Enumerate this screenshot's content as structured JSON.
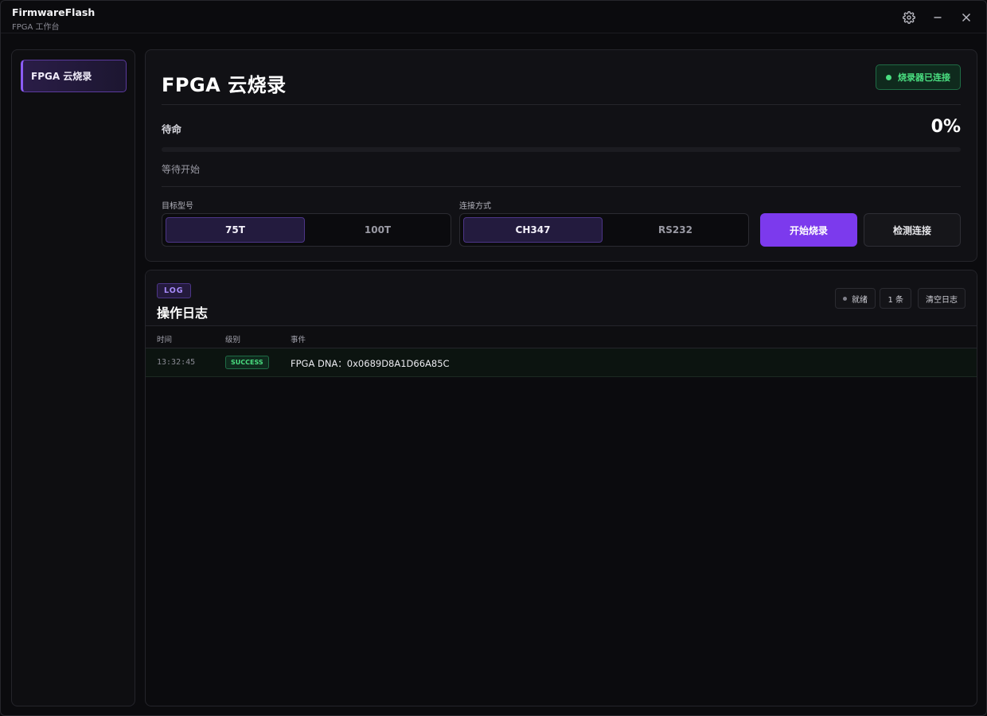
{
  "app": {
    "title": "FirmwareFlash",
    "subtitle": "FPGA 工作台"
  },
  "window_controls": {
    "settings_icon": "gear-icon",
    "minimize_icon": "minimize-icon",
    "close_icon": "close-icon"
  },
  "sidebar": {
    "items": [
      {
        "label": "FPGA 云烧录",
        "active": true
      }
    ]
  },
  "flash": {
    "title": "FPGA 云烧录",
    "connection_badge": "烧录器已连接",
    "status_label": "待命",
    "percent_text": "0%",
    "progress_fraction": 0,
    "status_message": "等待开始",
    "target_model": {
      "label": "目标型号",
      "options": [
        "75T",
        "100T"
      ],
      "selected": "75T"
    },
    "connection_mode": {
      "label": "连接方式",
      "options": [
        "CH347",
        "RS232"
      ],
      "selected": "CH347"
    },
    "start_button": "开始烧录",
    "detect_button": "检测连接"
  },
  "log": {
    "tag": "LOG",
    "title": "操作日志",
    "status_chip": "就绪",
    "count_chip": "1 条",
    "clear_button": "清空日志",
    "columns": {
      "time": "时间",
      "level": "级别",
      "event": "事件"
    },
    "rows": [
      {
        "time": "13:32:45",
        "level": "SUCCESS",
        "event": "FPGA DNA：0x0689D8A1D66A85C"
      }
    ]
  },
  "colors": {
    "accent": "#7c3aed",
    "success": "#4ade80",
    "background": "#0b0b0e"
  }
}
